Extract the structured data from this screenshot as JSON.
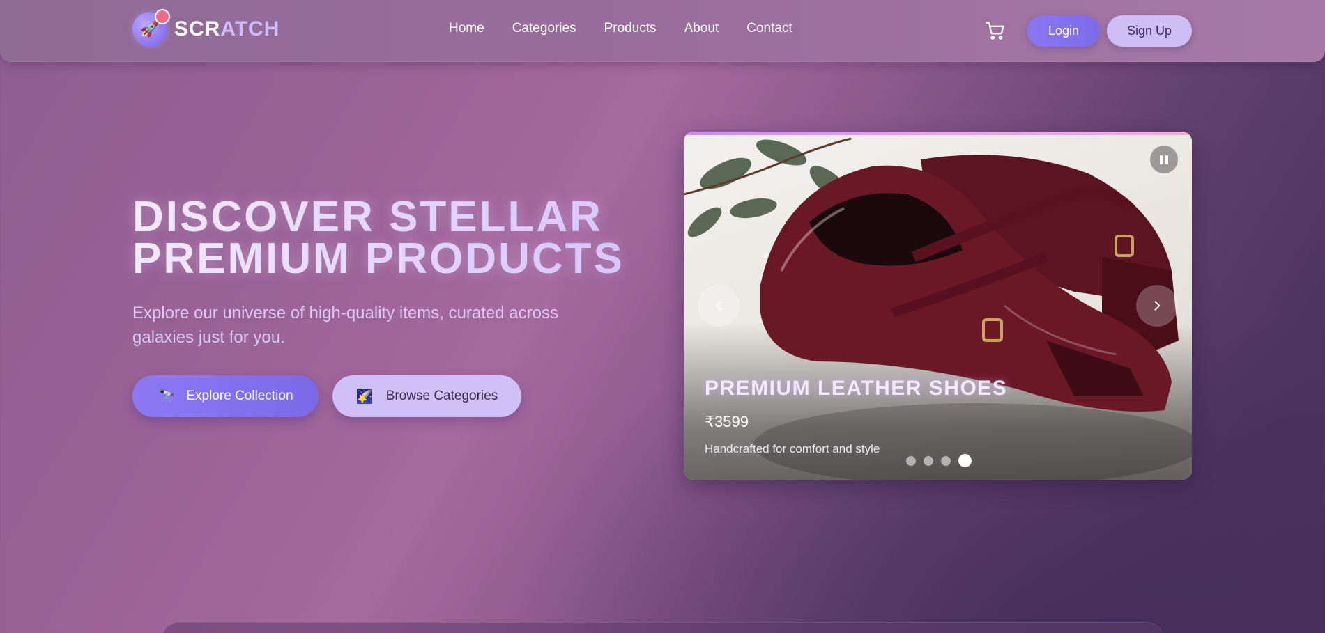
{
  "brand": {
    "name_part1": "SCR",
    "name_part2": "ATCH",
    "logo_icon": "rocket-icon"
  },
  "nav": {
    "links": [
      "Home",
      "Categories",
      "Products",
      "About",
      "Contact"
    ],
    "cart_icon": "cart-icon",
    "login_label": "Login",
    "signup_label": "Sign Up"
  },
  "hero": {
    "title_line1": "DISCOVER STELLAR",
    "title_line2": "PREMIUM PRODUCTS",
    "subtitle": "Explore our universe of high-quality items, curated across galaxies just for you.",
    "primary_button": {
      "icon": "🔭",
      "label": "Explore Collection"
    },
    "secondary_button": {
      "icon": "🌠",
      "label": "Browse Categories"
    }
  },
  "carousel": {
    "current_slide": {
      "title": "PREMIUM LEATHER SHOES",
      "price": "₹3599",
      "description": "Handcrafted for comfort and style"
    },
    "total_slides": 4,
    "active_index": 3
  },
  "colors": {
    "accent_purple": "#7c6be8",
    "light_lavender": "#cdbff5",
    "bg_mauve": "#9c6497",
    "bg_deep": "#49325c"
  }
}
